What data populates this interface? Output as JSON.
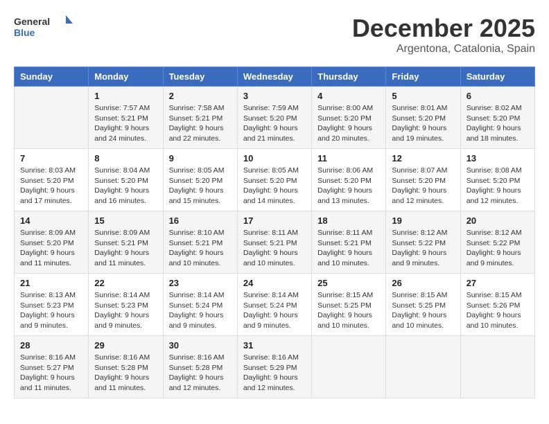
{
  "logo": {
    "line1": "General",
    "line2": "Blue"
  },
  "title": "December 2025",
  "subtitle": "Argentona, Catalonia, Spain",
  "days_header": [
    "Sunday",
    "Monday",
    "Tuesday",
    "Wednesday",
    "Thursday",
    "Friday",
    "Saturday"
  ],
  "weeks": [
    [
      {
        "day": "",
        "info": ""
      },
      {
        "day": "1",
        "info": "Sunrise: 7:57 AM\nSunset: 5:21 PM\nDaylight: 9 hours\nand 24 minutes."
      },
      {
        "day": "2",
        "info": "Sunrise: 7:58 AM\nSunset: 5:21 PM\nDaylight: 9 hours\nand 22 minutes."
      },
      {
        "day": "3",
        "info": "Sunrise: 7:59 AM\nSunset: 5:20 PM\nDaylight: 9 hours\nand 21 minutes."
      },
      {
        "day": "4",
        "info": "Sunrise: 8:00 AM\nSunset: 5:20 PM\nDaylight: 9 hours\nand 20 minutes."
      },
      {
        "day": "5",
        "info": "Sunrise: 8:01 AM\nSunset: 5:20 PM\nDaylight: 9 hours\nand 19 minutes."
      },
      {
        "day": "6",
        "info": "Sunrise: 8:02 AM\nSunset: 5:20 PM\nDaylight: 9 hours\nand 18 minutes."
      }
    ],
    [
      {
        "day": "7",
        "info": "Sunrise: 8:03 AM\nSunset: 5:20 PM\nDaylight: 9 hours\nand 17 minutes."
      },
      {
        "day": "8",
        "info": "Sunrise: 8:04 AM\nSunset: 5:20 PM\nDaylight: 9 hours\nand 16 minutes."
      },
      {
        "day": "9",
        "info": "Sunrise: 8:05 AM\nSunset: 5:20 PM\nDaylight: 9 hours\nand 15 minutes."
      },
      {
        "day": "10",
        "info": "Sunrise: 8:05 AM\nSunset: 5:20 PM\nDaylight: 9 hours\nand 14 minutes."
      },
      {
        "day": "11",
        "info": "Sunrise: 8:06 AM\nSunset: 5:20 PM\nDaylight: 9 hours\nand 13 minutes."
      },
      {
        "day": "12",
        "info": "Sunrise: 8:07 AM\nSunset: 5:20 PM\nDaylight: 9 hours\nand 12 minutes."
      },
      {
        "day": "13",
        "info": "Sunrise: 8:08 AM\nSunset: 5:20 PM\nDaylight: 9 hours\nand 12 minutes."
      }
    ],
    [
      {
        "day": "14",
        "info": "Sunrise: 8:09 AM\nSunset: 5:20 PM\nDaylight: 9 hours\nand 11 minutes."
      },
      {
        "day": "15",
        "info": "Sunrise: 8:09 AM\nSunset: 5:21 PM\nDaylight: 9 hours\nand 11 minutes."
      },
      {
        "day": "16",
        "info": "Sunrise: 8:10 AM\nSunset: 5:21 PM\nDaylight: 9 hours\nand 10 minutes."
      },
      {
        "day": "17",
        "info": "Sunrise: 8:11 AM\nSunset: 5:21 PM\nDaylight: 9 hours\nand 10 minutes."
      },
      {
        "day": "18",
        "info": "Sunrise: 8:11 AM\nSunset: 5:21 PM\nDaylight: 9 hours\nand 10 minutes."
      },
      {
        "day": "19",
        "info": "Sunrise: 8:12 AM\nSunset: 5:22 PM\nDaylight: 9 hours\nand 9 minutes."
      },
      {
        "day": "20",
        "info": "Sunrise: 8:12 AM\nSunset: 5:22 PM\nDaylight: 9 hours\nand 9 minutes."
      }
    ],
    [
      {
        "day": "21",
        "info": "Sunrise: 8:13 AM\nSunset: 5:23 PM\nDaylight: 9 hours\nand 9 minutes."
      },
      {
        "day": "22",
        "info": "Sunrise: 8:14 AM\nSunset: 5:23 PM\nDaylight: 9 hours\nand 9 minutes."
      },
      {
        "day": "23",
        "info": "Sunrise: 8:14 AM\nSunset: 5:24 PM\nDaylight: 9 hours\nand 9 minutes."
      },
      {
        "day": "24",
        "info": "Sunrise: 8:14 AM\nSunset: 5:24 PM\nDaylight: 9 hours\nand 9 minutes."
      },
      {
        "day": "25",
        "info": "Sunrise: 8:15 AM\nSunset: 5:25 PM\nDaylight: 9 hours\nand 10 minutes."
      },
      {
        "day": "26",
        "info": "Sunrise: 8:15 AM\nSunset: 5:25 PM\nDaylight: 9 hours\nand 10 minutes."
      },
      {
        "day": "27",
        "info": "Sunrise: 8:15 AM\nSunset: 5:26 PM\nDaylight: 9 hours\nand 10 minutes."
      }
    ],
    [
      {
        "day": "28",
        "info": "Sunrise: 8:16 AM\nSunset: 5:27 PM\nDaylight: 9 hours\nand 11 minutes."
      },
      {
        "day": "29",
        "info": "Sunrise: 8:16 AM\nSunset: 5:28 PM\nDaylight: 9 hours\nand 11 minutes."
      },
      {
        "day": "30",
        "info": "Sunrise: 8:16 AM\nSunset: 5:28 PM\nDaylight: 9 hours\nand 12 minutes."
      },
      {
        "day": "31",
        "info": "Sunrise: 8:16 AM\nSunset: 5:29 PM\nDaylight: 9 hours\nand 12 minutes."
      },
      {
        "day": "",
        "info": ""
      },
      {
        "day": "",
        "info": ""
      },
      {
        "day": "",
        "info": ""
      }
    ]
  ]
}
